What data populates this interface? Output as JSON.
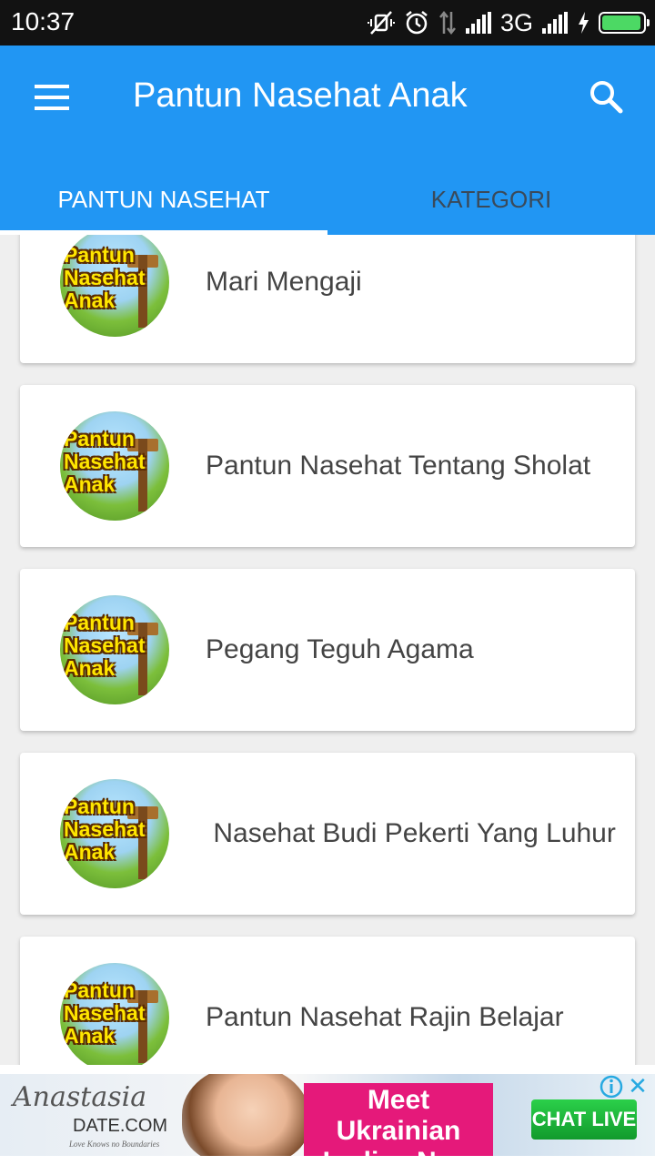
{
  "status_bar": {
    "time": "10:37",
    "network": "3G",
    "icons": [
      "mute-icon",
      "alarm-icon",
      "data-arrows-icon",
      "signal-icon",
      "signal-icon",
      "charging-icon",
      "battery-icon"
    ],
    "battery_level": 0.95,
    "battery_color": "#4cd964"
  },
  "app_bar": {
    "title": "Pantun Nasehat Anak",
    "color": "#2196f3",
    "menu_icon": "hamburger-menu-icon",
    "search_icon": "search-icon"
  },
  "tabs": [
    {
      "label": "PANTUN NASEHAT",
      "active": true
    },
    {
      "label": "KATEGORI",
      "active": false
    }
  ],
  "thumbnail_logo": [
    "Pantun",
    "Nasehat",
    "Anak"
  ],
  "items": [
    {
      "title": "Mari Mengaji"
    },
    {
      "title": "Pantun Nasehat Tentang Sholat"
    },
    {
      "title": "Pegang Teguh Agama"
    },
    {
      "title": " Nasehat Budi Pekerti Yang Luhur"
    },
    {
      "title": "Pantun Nasehat Rajin Belajar"
    }
  ],
  "ad": {
    "brand": "Anastasia",
    "brand_domain": "DATE.COM",
    "tagline": "Love Knows no Boundaries",
    "headline": "Meet Ukrainian Ladies Now",
    "cta": "CHAT LIVE",
    "info_icon": "ad-info-icon",
    "close_icon": "close-icon",
    "close_glyph": "✕"
  }
}
